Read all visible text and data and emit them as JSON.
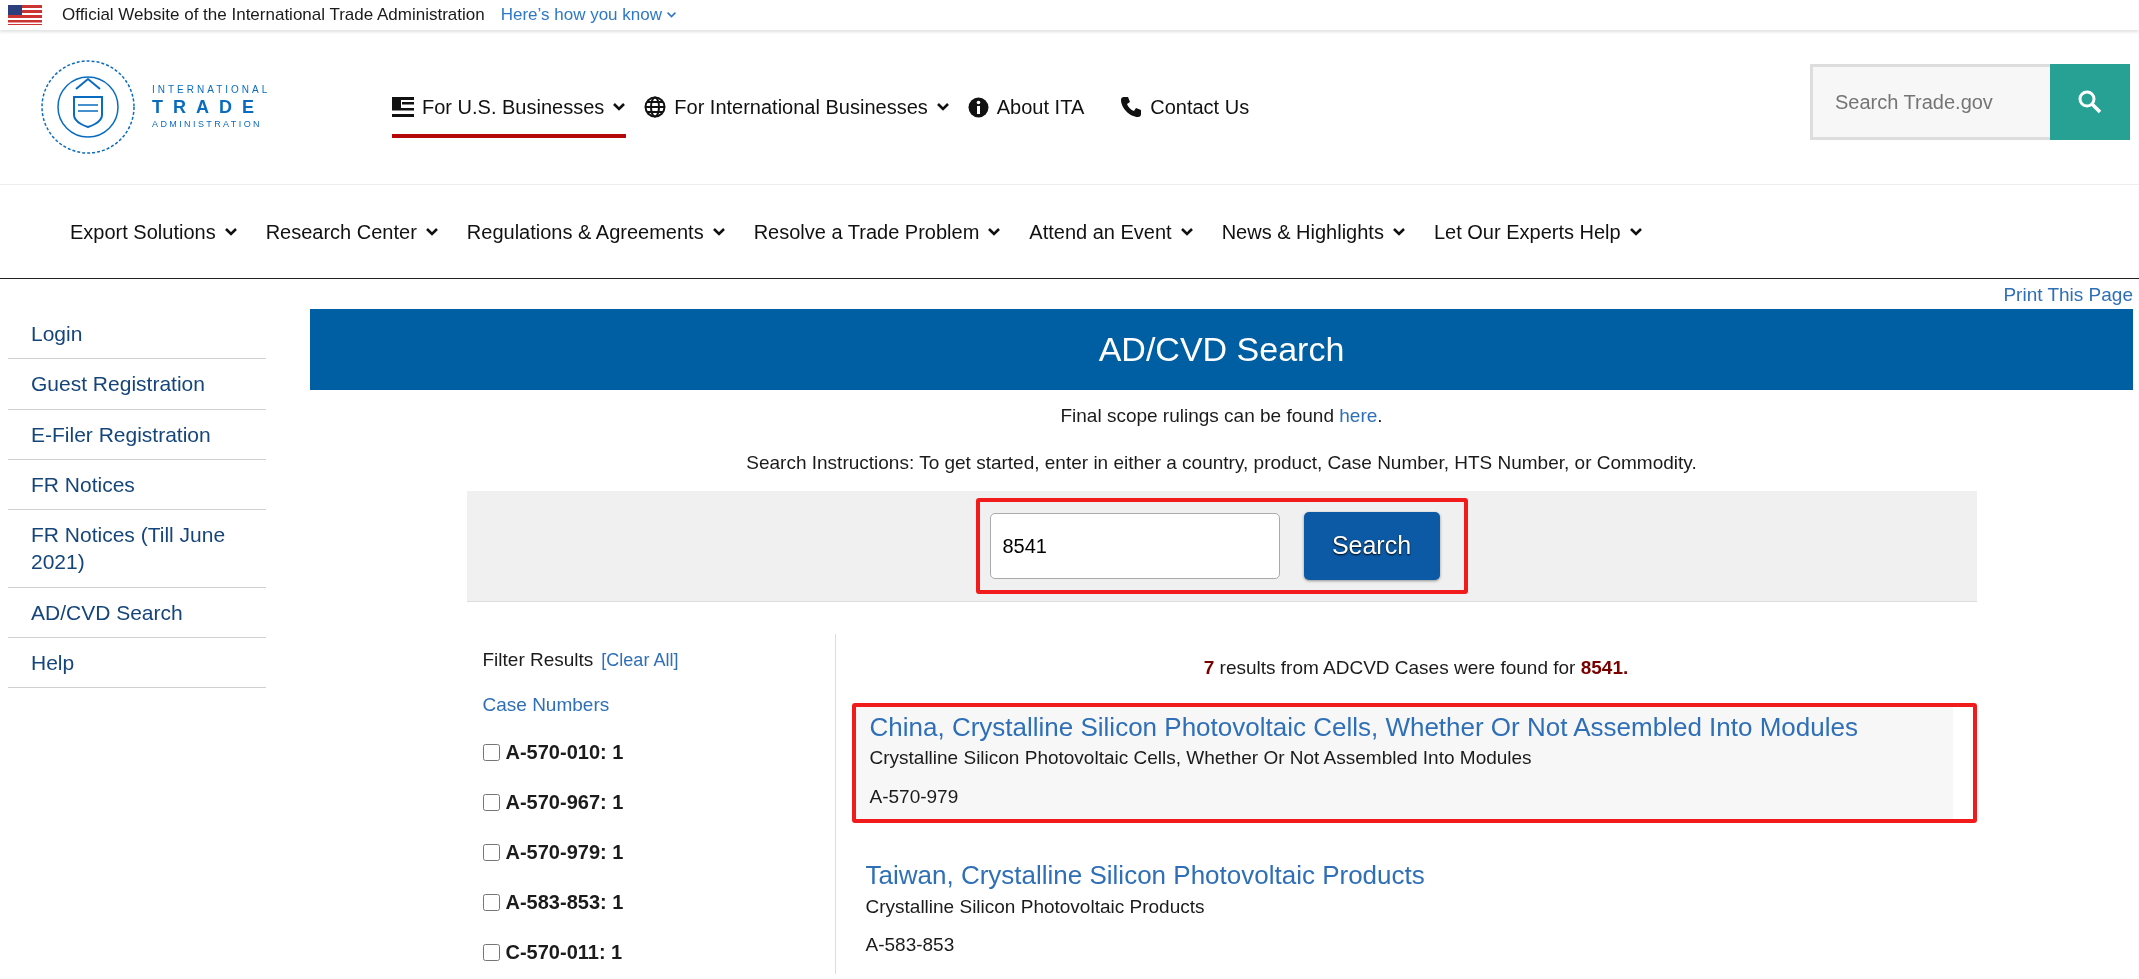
{
  "banner": {
    "text": "Official Website of the International Trade Administration",
    "link": "Here’s how you know"
  },
  "logo": {
    "line_1": "INTERNATIONAL",
    "line_2": "TRADE",
    "line_3": "ADMINISTRATION"
  },
  "main_nav": [
    {
      "label": "For U.S. Businesses",
      "kind": "flag",
      "dropdown": true,
      "selected": true
    },
    {
      "label": "For International Businesses",
      "kind": "globe",
      "dropdown": true,
      "selected": false
    },
    {
      "label": "About ITA",
      "kind": "info",
      "dropdown": false,
      "selected": false
    },
    {
      "label": "Contact Us",
      "kind": "phone",
      "dropdown": false,
      "selected": false
    }
  ],
  "site_search": {
    "placeholder": "Search Trade.gov"
  },
  "sub_nav": [
    "Export Solutions",
    "Research Center",
    "Regulations & Agreements",
    "Resolve a Trade Problem",
    "Attend an Event",
    "News & Highlights",
    "Let Our Experts Help"
  ],
  "print_link": "Print This Page",
  "sidebar": {
    "items": [
      "Login",
      "Guest Registration",
      "E-Filer Registration",
      "FR Notices",
      "FR Notices (Till June 2021)",
      "AD/CVD Search",
      "Help"
    ]
  },
  "page_title": "AD/CVD Search",
  "scope_note": {
    "text": "Final scope rulings can be found ",
    "link": "here",
    "end": "."
  },
  "instructions": "Search Instructions: To get started, enter in either a country, product, Case Number, HTS Number, or Commodity.",
  "search": {
    "value": "8541",
    "button": "Search",
    "highlighted": true
  },
  "filter": {
    "title": "Filter Results",
    "clear": "[Clear All]",
    "group": "Case Numbers",
    "options": [
      {
        "label": "A-570-010: 1",
        "checked": false
      },
      {
        "label": "A-570-967: 1",
        "checked": false
      },
      {
        "label": "A-570-979: 1",
        "checked": false
      },
      {
        "label": "A-583-853: 1",
        "checked": false
      },
      {
        "label": "C-570-011: 1",
        "checked": false
      }
    ]
  },
  "summary": "**7** results from ADCVD Cases were found for **8541.**",
  "results": [
    {
      "title": "China, Crystalline Silicon Photovoltaic Cells, Whether Or Not Assembled Into Modules",
      "product": "Crystalline Silicon Photovoltaic Cells, Whether Or Not Assembled Into Modules",
      "case": "A-570-979",
      "highlighted": true
    },
    {
      "title": "Taiwan, Crystalline Silicon Photovoltaic Products",
      "product": "Crystalline Silicon Photovoltaic Products",
      "case": "A-583-853",
      "highlighted": false
    }
  ]
}
